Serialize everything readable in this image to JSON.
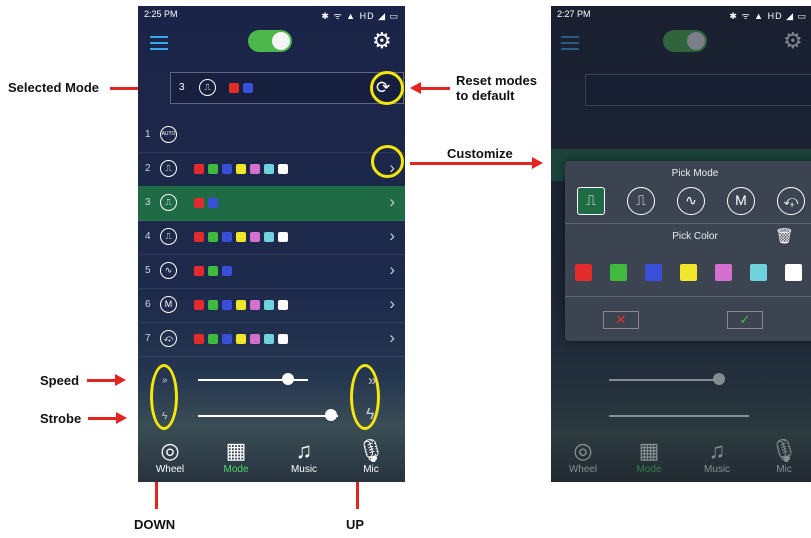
{
  "annotations": {
    "selected_mode": "Selected Mode",
    "reset_modes": "Reset modes\nto default",
    "customize": "Customize",
    "speed": "Speed",
    "strobe": "Strobe",
    "down": "DOWN",
    "up": "UP"
  },
  "colors": {
    "annotation_arrow": "#e32521",
    "highlight_ring": "#f5e60b",
    "selected_row": "#1f6b45",
    "toggle_on": "#4cb84c",
    "active_tab": "#4cd964"
  },
  "phone1": {
    "status_time": "2:25 PM",
    "status_icons": "✱ ᯤ ▲ HD ◢ ▭",
    "selected_mode": {
      "number": "3",
      "icon": "pulse-icon",
      "swatches": [
        "#e32b2b",
        "#3a4fd8"
      ]
    },
    "rows": [
      {
        "num": "1",
        "icon_text": "AUTO",
        "icon": "auto-icon",
        "swatches": [],
        "chevron": ""
      },
      {
        "num": "2",
        "icon_text": "⎍",
        "icon": "square-wave-icon",
        "swatches": [
          "#e32b2b",
          "#3fba3f",
          "#3a4fd8",
          "#f2e62a",
          "#d56fd0",
          "#6fd3dd",
          "#ffffff"
        ],
        "chevron": "›"
      },
      {
        "num": "3",
        "icon_text": "⎍",
        "icon": "pulse-icon",
        "swatches": [
          "#e32b2b",
          "#3a4fd8"
        ],
        "chevron": "›"
      },
      {
        "num": "4",
        "icon_text": "⎍",
        "icon": "pulse-icon",
        "swatches": [
          "#e32b2b",
          "#3fba3f",
          "#3a4fd8",
          "#f2e62a",
          "#d56fd0",
          "#6fd3dd",
          "#ffffff"
        ],
        "chevron": "›"
      },
      {
        "num": "5",
        "icon_text": "∿",
        "icon": "sine-wave-icon",
        "swatches": [
          "#e32b2b",
          "#3fba3f",
          "#3a4fd8"
        ],
        "chevron": "›"
      },
      {
        "num": "6",
        "icon_text": "M",
        "icon": "double-hump-icon",
        "swatches": [
          "#e32b2b",
          "#3fba3f",
          "#3a4fd8",
          "#f2e62a",
          "#d56fd0",
          "#6fd3dd",
          "#ffffff"
        ],
        "chevron": "›"
      },
      {
        "num": "7",
        "icon_text": "⤽",
        "icon": "sawtooth-icon",
        "swatches": [
          "#e32b2b",
          "#3fba3f",
          "#3a4fd8",
          "#f2e62a",
          "#d56fd0",
          "#6fd3dd",
          "#ffffff"
        ],
        "chevron": "›"
      }
    ],
    "speed_level": 0.82,
    "strobe_level": 0.95,
    "tabs": [
      {
        "label": "Wheel",
        "icon": "wheel-icon",
        "glyph": "◎"
      },
      {
        "label": "Mode",
        "icon": "mode-icon",
        "glyph": "▦"
      },
      {
        "label": "Music",
        "icon": "music-icon",
        "glyph": "♫"
      },
      {
        "label": "Mic",
        "icon": "mic-icon",
        "glyph": "🎙"
      }
    ]
  },
  "phone2": {
    "status_time": "2:27 PM",
    "status_icons": "✱ ᯤ ▲ HD ◢ ▭",
    "pick_mode_title": "Pick Mode",
    "modes": [
      "⎍",
      "⎍",
      "∿",
      "M",
      "⤽"
    ],
    "pick_color_title": "Pick Color",
    "colors": [
      "#e32b2b",
      "#3fba3f",
      "#3a4fd8",
      "#f2e62a",
      "#d56fd0",
      "#6fd3dd",
      "#ffffff"
    ],
    "cancel": "✕",
    "confirm": "✓",
    "tabs": [
      {
        "label": "Wheel"
      },
      {
        "label": "Mode"
      },
      {
        "label": "Music"
      },
      {
        "label": "Mic"
      }
    ]
  }
}
